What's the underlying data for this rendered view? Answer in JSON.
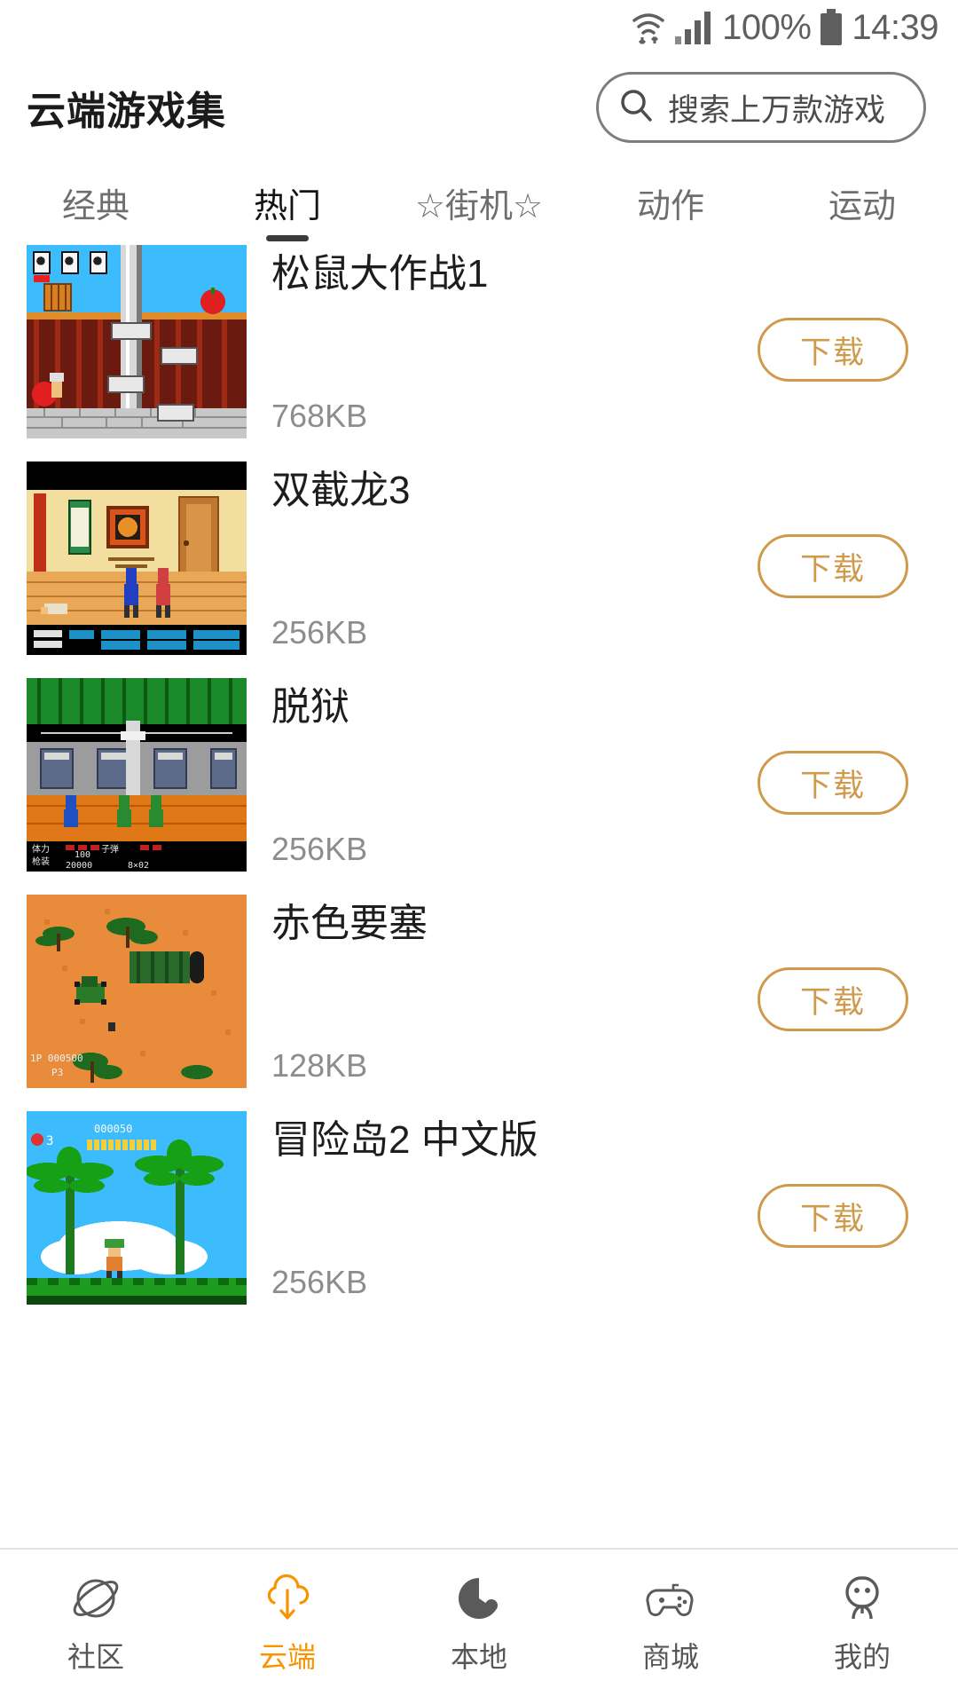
{
  "status_bar": {
    "battery_percent": "100%",
    "time": "14:39",
    "icons": [
      "wifi-icon",
      "signal-icon",
      "battery-icon"
    ]
  },
  "header": {
    "title": "云端游戏集",
    "search": {
      "placeholder": "搜索上万款游戏",
      "icon": "search-icon"
    }
  },
  "tabs": [
    {
      "label": "经典",
      "active": false
    },
    {
      "label": "热门",
      "active": true
    },
    {
      "label": "☆街机☆",
      "active": false
    },
    {
      "label": "动作",
      "active": false
    },
    {
      "label": "运动",
      "active": false
    }
  ],
  "games": [
    {
      "title": "松鼠大作战1",
      "size": "768KB",
      "download_label": "下载",
      "thumb": "squirrel-battle-thumb"
    },
    {
      "title": "双截龙3",
      "size": "256KB",
      "download_label": "下载",
      "thumb": "double-dragon-thumb"
    },
    {
      "title": "脱狱",
      "size": "256KB",
      "download_label": "下载",
      "thumb": "prison-break-thumb"
    },
    {
      "title": "赤色要塞",
      "size": "128KB",
      "download_label": "下载",
      "thumb": "jackal-thumb"
    },
    {
      "title": "冒险岛2 中文版",
      "size": "256KB",
      "download_label": "下载",
      "thumb": "adventure-island-thumb"
    }
  ],
  "bottom_nav": [
    {
      "label": "社区",
      "icon": "planet-icon",
      "active": false
    },
    {
      "label": "云端",
      "icon": "cloud-download-icon",
      "active": true
    },
    {
      "label": "本地",
      "icon": "local-disc-icon",
      "active": false
    },
    {
      "label": "商城",
      "icon": "gamepad-icon",
      "active": false
    },
    {
      "label": "我的",
      "icon": "person-icon",
      "active": false
    }
  ],
  "colors": {
    "accent_orange": "#f79400",
    "button_orange": "#cf9a4c",
    "text_primary": "#1d1d1d",
    "text_secondary": "#8d8d8d"
  }
}
